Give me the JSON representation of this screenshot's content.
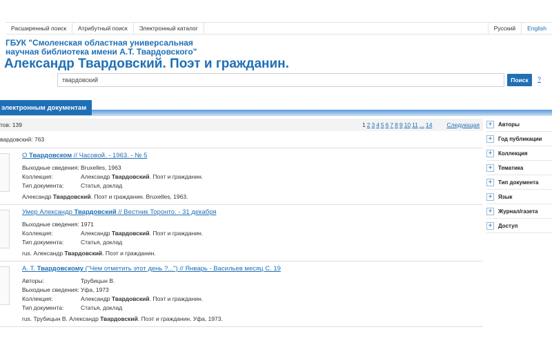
{
  "nav": {
    "items": [
      "Расширенный поиск",
      "Атрибутный поиск",
      "Электронный каталог"
    ],
    "languages": [
      "Русский",
      "English"
    ]
  },
  "header": {
    "org_line1": "ГБУК \"Смоленская областная универсальная",
    "org_line2": "научная библиотека имени А.Т. Твардовского\"",
    "collection": "Александр Твардовский. Поэт и гражданин."
  },
  "search": {
    "value": "твардовский",
    "button": "Поиск",
    "help": "?"
  },
  "tab": {
    "label": "электронным документам"
  },
  "results": {
    "count": "тов: 139",
    "query_count": "вардовский: 763",
    "pager": {
      "pages": [
        "1",
        "2",
        "3",
        "4",
        "5",
        "6",
        "7",
        "8",
        "9",
        "10",
        "11",
        "...",
        "14"
      ],
      "current": "1",
      "next": "Следующая"
    }
  },
  "records": [
    {
      "title_pre": "О ",
      "title_hl": "Твардовском",
      "title_post": " // Часовой. - 1963. - № 5",
      "fields": [
        {
          "label": "Выходные сведения:",
          "value": "Bruxelles, 1963"
        },
        {
          "label": "Коллекция:",
          "value_pre": "Александр ",
          "value_hl": "Твардовский",
          "value_post": ". Поэт и гражданин."
        },
        {
          "label": "Тип документа:",
          "value": "Статья, доклад"
        }
      ],
      "summary_pre": "Александр ",
      "summary_hl": "Твардовский",
      "summary_post": ". Поэт и гражданин. Bruxelles, 1963."
    },
    {
      "title_pre": "Умер Александр ",
      "title_hl": "Твардовский",
      "title_post": " // Вестник Торонто. - 31 декабря",
      "fields": [
        {
          "label": "Выходные сведения:",
          "value": "1971"
        },
        {
          "label": "Коллекция:",
          "value_pre": "Александр ",
          "value_hl": "Твардовский",
          "value_post": ". Поэт и гражданин."
        },
        {
          "label": "Тип документа:",
          "value": "Статья, доклад"
        }
      ],
      "summary_pre": "rus. Александр ",
      "summary_hl": "Твардовский",
      "summary_post": ". Поэт и гражданин."
    },
    {
      "title_pre": "А. Т. ",
      "title_hl": "Твардовскому",
      "title_post": " (\"Чем отметить этот день ?...\") // Январь - Васильев месяц С. 19",
      "fields": [
        {
          "label": "Авторы:",
          "value": "Трубицын В."
        },
        {
          "label": "Выходные сведения:",
          "value": "Уфа, 1973"
        },
        {
          "label": "Коллекция:",
          "value_pre": "Александр ",
          "value_hl": "Твардовский",
          "value_post": ". Поэт и гражданин."
        },
        {
          "label": "Тип документа:",
          "value": "Статья, доклад"
        }
      ],
      "summary_pre": "rus. Трубицын В. Александр ",
      "summary_hl": "Твардовский",
      "summary_post": ". Поэт и гражданин. Уфа, 1973."
    }
  ],
  "facets": [
    "Авторы",
    "Год публикации",
    "Коллекция",
    "Тематика",
    "Тип документа",
    "Язык",
    "Журнал/газета",
    "Доступ"
  ],
  "facet_icon": "plus-icon",
  "colors": {
    "accent": "#1f6fb5"
  }
}
